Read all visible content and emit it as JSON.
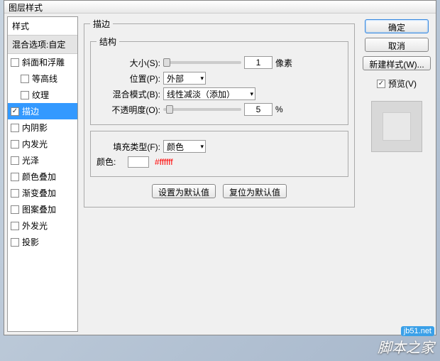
{
  "title": "图层样式",
  "sidebar": {
    "header": "样式",
    "blend": "混合选项:自定",
    "items": [
      {
        "label": "斜面和浮雕",
        "checked": false,
        "indent": false
      },
      {
        "label": "等高线",
        "checked": false,
        "indent": true
      },
      {
        "label": "纹理",
        "checked": false,
        "indent": true
      },
      {
        "label": "描边",
        "checked": true,
        "indent": false,
        "selected": true
      },
      {
        "label": "内阴影",
        "checked": false,
        "indent": false
      },
      {
        "label": "内发光",
        "checked": false,
        "indent": false
      },
      {
        "label": "光泽",
        "checked": false,
        "indent": false
      },
      {
        "label": "颜色叠加",
        "checked": false,
        "indent": false
      },
      {
        "label": "渐变叠加",
        "checked": false,
        "indent": false
      },
      {
        "label": "图案叠加",
        "checked": false,
        "indent": false
      },
      {
        "label": "外发光",
        "checked": false,
        "indent": false
      },
      {
        "label": "投影",
        "checked": false,
        "indent": false
      }
    ]
  },
  "main": {
    "group_title": "描边",
    "struct_title": "结构",
    "size_label": "大小(S):",
    "size_value": "1",
    "size_unit": "像素",
    "position_label": "位置(P):",
    "position_value": "外部",
    "blendmode_label": "混合模式(B):",
    "blendmode_value": "线性减淡（添加）",
    "opacity_label": "不透明度(O):",
    "opacity_value": "5",
    "opacity_unit": "%",
    "filltype_label": "填充类型(F):",
    "filltype_value": "颜色",
    "color_label": "颜色:",
    "color_hex": "#ffffff",
    "btn_set_default": "设置为默认值",
    "btn_reset_default": "复位为默认值"
  },
  "right": {
    "ok": "确定",
    "cancel": "取消",
    "new_style": "新建样式(W)...",
    "preview_label": "预览(V)",
    "preview_checked": true
  },
  "watermark": {
    "logo": "jb51.net",
    "text": "脚本之家"
  }
}
